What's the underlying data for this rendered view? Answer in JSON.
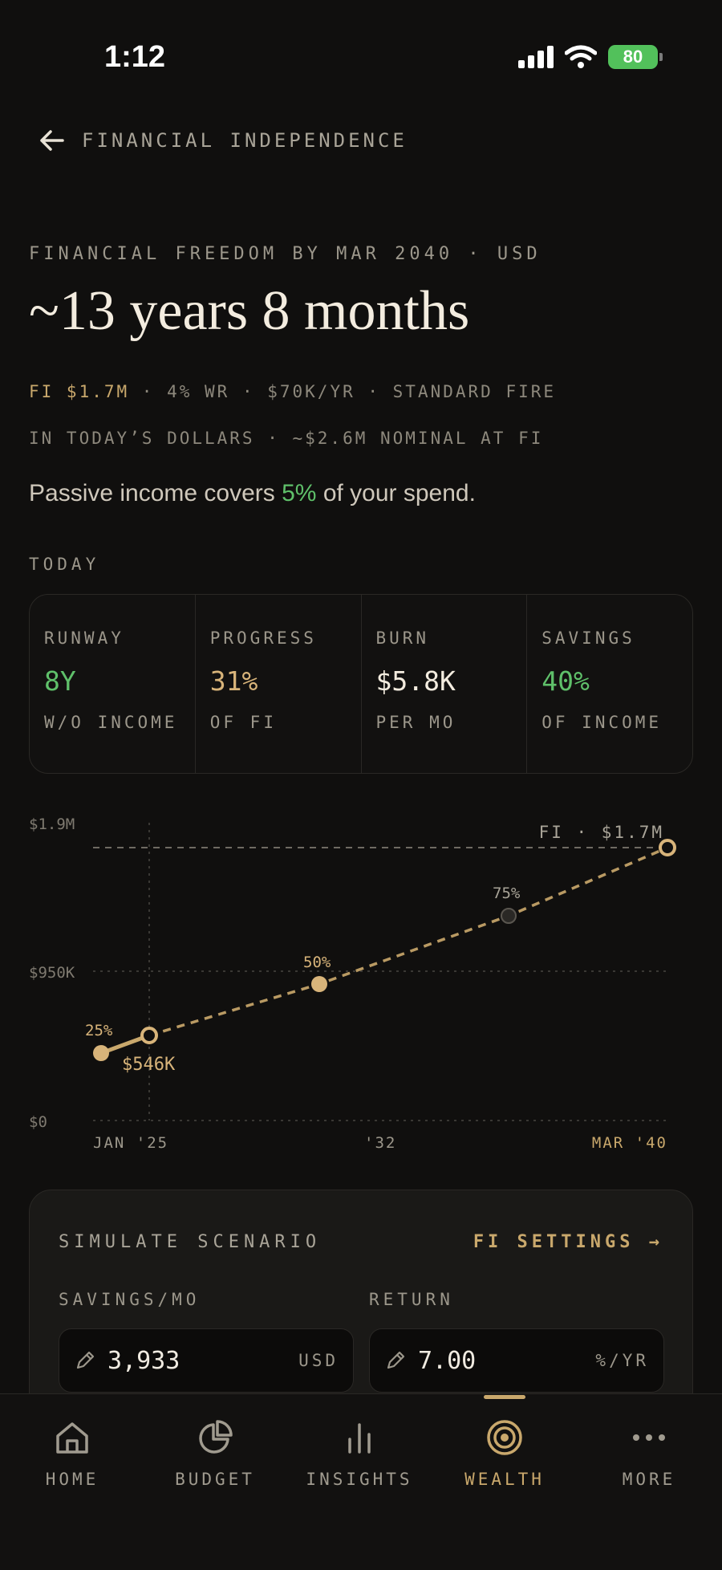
{
  "status_bar": {
    "time": "1:12",
    "battery": "80"
  },
  "header": {
    "back_label": "FINANCIAL INDEPENDENCE"
  },
  "summary": {
    "eyebrow": "FINANCIAL FREEDOM BY MAR 2040 · USD",
    "headline": "~13 years 8 months",
    "meta_fi": "FI $1.7M",
    "meta_rest": " · 4% WR · $70K/YR · STANDARD FIRE",
    "meta_line2": "IN TODAY’S DOLLARS · ~$2.6M NOMINAL AT FI",
    "passive_prefix": "Passive income covers ",
    "passive_pct": "5%",
    "passive_suffix": " of your spend."
  },
  "today": {
    "label": "TODAY",
    "stats": [
      {
        "label": "RUNWAY",
        "value": "8Y",
        "sub": "W/O INCOME",
        "color": "#5fc06a"
      },
      {
        "label": "PROGRESS",
        "value": "31%",
        "sub": "OF FI",
        "color": "#d8b47a"
      },
      {
        "label": "BURN",
        "value": "$5.8K",
        "sub": "PER MO",
        "color": "#f3ecdf"
      },
      {
        "label": "SAVINGS",
        "value": "40%",
        "sub": "OF INCOME",
        "color": "#5fc06a"
      }
    ]
  },
  "chart_data": {
    "type": "line",
    "y_ticks": [
      "$1.9M",
      "$950K",
      "$0"
    ],
    "x_ticks": [
      "JAN '25",
      "'32",
      "MAR '40"
    ],
    "fi_label": "FI · $1.7M",
    "current_label": "$546K",
    "milestones": [
      "25%",
      "50%",
      "75%"
    ],
    "ylim": [
      0,
      1900000
    ],
    "fi_target": 1700000,
    "history": [
      {
        "x": "2024",
        "y": 425000
      },
      {
        "x": "Jan 2025",
        "y": 546000
      }
    ],
    "projection": [
      {
        "x": "Jan 2025",
        "y": 546000
      },
      {
        "x": "2028",
        "y": 850000
      },
      {
        "x": "2036",
        "y": 1300000
      },
      {
        "x": "Mar 2040",
        "y": 1700000
      }
    ]
  },
  "scenario": {
    "title": "SIMULATE SCENARIO",
    "settings_link": "FI SETTINGS →",
    "savings_label": "SAVINGS/MO",
    "savings_value": "3,933",
    "savings_unit": "USD",
    "return_label": "RETURN",
    "return_value": "7.00",
    "return_unit": "%/YR"
  },
  "tabs": [
    {
      "label": "HOME",
      "icon": "home-icon"
    },
    {
      "label": "BUDGET",
      "icon": "pie-chart-icon"
    },
    {
      "label": "INSIGHTS",
      "icon": "bar-chart-icon"
    },
    {
      "label": "WEALTH",
      "icon": "target-icon"
    },
    {
      "label": "MORE",
      "icon": "more-dots-icon"
    }
  ],
  "colors": {
    "accent": "#c9a86c",
    "positive": "#5fc06a",
    "background": "#100f0e"
  }
}
